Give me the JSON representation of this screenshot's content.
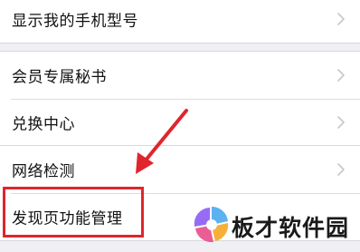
{
  "settings": {
    "group1": [
      {
        "label": "显示我的手机型号"
      }
    ],
    "group2": [
      {
        "label": "会员专属秘书"
      },
      {
        "label": "兑换中心"
      }
    ],
    "group3": [
      {
        "label": "网络检测"
      },
      {
        "label": "发现页功能管理"
      }
    ]
  },
  "watermark": {
    "text": "板才软件园"
  },
  "colors": {
    "highlight": "#e0252d",
    "background": "#efeff4",
    "chevron": "#c7c7cc"
  },
  "icons": {
    "chevron": "chevron-right-icon",
    "arrow": "red-arrow-icon"
  }
}
